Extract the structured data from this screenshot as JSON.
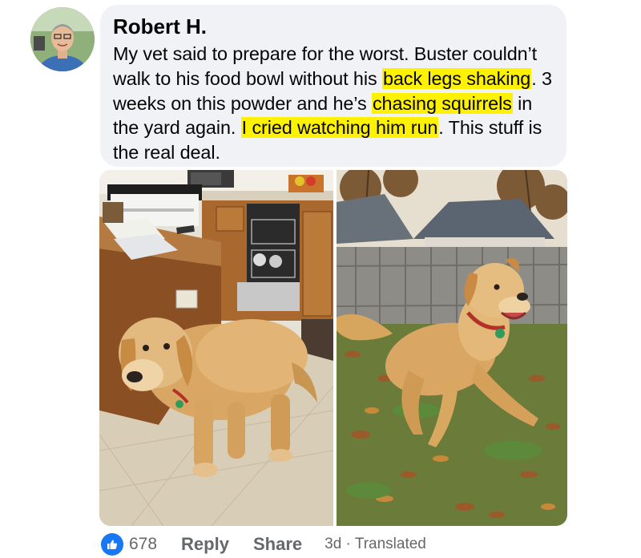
{
  "comment": {
    "author": "Robert H.",
    "segments": [
      {
        "text": "My vet said to prepare for the worst. Buster couldn’t walk to his food bowl without his ",
        "highlight": false
      },
      {
        "text": "back legs shaking",
        "highlight": true
      },
      {
        "text": ". 3 weeks on this powder and he’s ",
        "highlight": false
      },
      {
        "text": "chasing squirrels",
        "highlight": true
      },
      {
        "text": " in the yard again. ",
        "highlight": false
      },
      {
        "text": "I cried watching him run",
        "highlight": true
      },
      {
        "text": ". This stuff is the real deal.",
        "highlight": false
      }
    ],
    "highlight_color": "#fff200",
    "bubble_color": "#f0f2f5"
  },
  "photos": [
    {
      "icon": "before-photo-kitchen-dog"
    },
    {
      "icon": "after-photo-yard-dog-running"
    }
  ],
  "actions": {
    "like_icon": "thumbs-up-icon",
    "like_count": "678",
    "reply_label": "Reply",
    "share_label": "Share",
    "time": "3d",
    "separator": "·",
    "translated_label": "Translated",
    "accent": "#1877f2"
  }
}
